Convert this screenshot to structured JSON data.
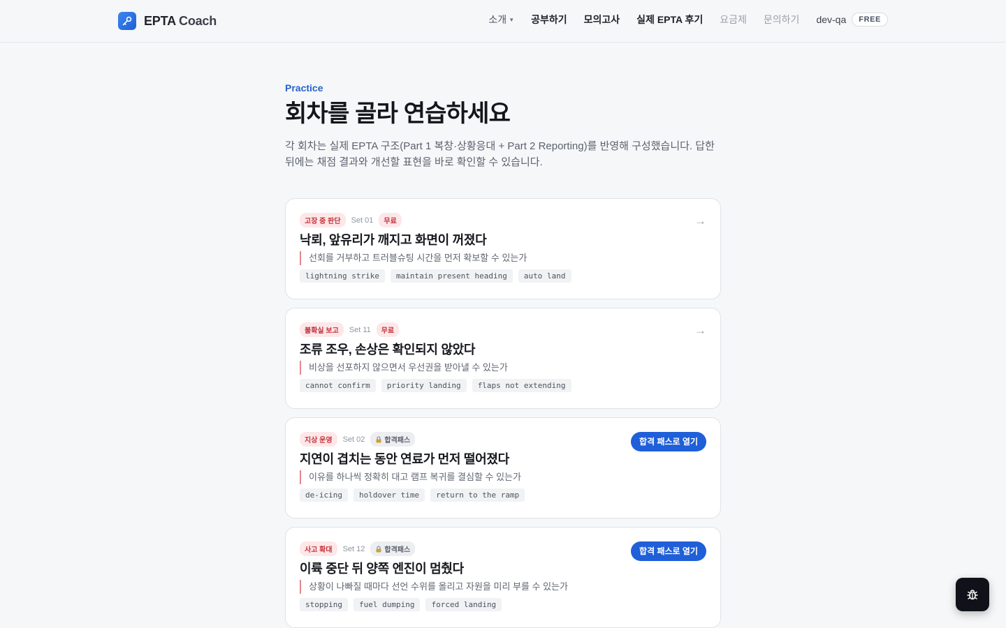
{
  "brand": {
    "name": "EPTA",
    "suffix": "Coach"
  },
  "nav": {
    "items": [
      {
        "label": "소개"
      },
      {
        "label": "공부하기"
      },
      {
        "label": "모의고사"
      },
      {
        "label": "실제 EPTA 후기"
      },
      {
        "label": "요금제"
      },
      {
        "label": "문의하기"
      }
    ],
    "user": "dev-qa",
    "plan": "FREE"
  },
  "intro": {
    "eyebrow": "Practice",
    "title": "회차를 골라 연습하세요",
    "description": "각 회차는 실제 EPTA 구조(Part 1 복창·상황응대 + Part 2 Reporting)를 반영해 구성했습니다. 답한 뒤에는 채점 결과와 개선할 표현을 바로 확인할 수 있습니다."
  },
  "cards": [
    {
      "category": "고장 중 판단",
      "set": "Set 01",
      "access": "무료",
      "title": "낙뢰, 앞유리가 깨지고 화면이 꺼졌다",
      "subtitle": "선회를 거부하고 트러블슈팅 시간을 먼저 확보할 수 있는가",
      "keywords": [
        "lightning strike",
        "maintain present heading",
        "auto land"
      ]
    },
    {
      "category": "불확실 보고",
      "set": "Set 11",
      "access": "무료",
      "title": "조류 조우, 손상은 확인되지 않았다",
      "subtitle": "비상을 선포하지 않으면서 우선권을 받아낼 수 있는가",
      "keywords": [
        "cannot confirm",
        "priority landing",
        "flaps not extending"
      ]
    },
    {
      "category": "지상 운영",
      "set": "Set 02",
      "access": "합격패스",
      "cta": "합격 패스로 열기",
      "title": "지연이 겹치는 동안 연료가 먼저 떨어졌다",
      "subtitle": "이유를 하나씩 정확히 대고 램프 복귀를 결심할 수 있는가",
      "keywords": [
        "de-icing",
        "holdover time",
        "return to the ramp"
      ]
    },
    {
      "category": "사고 확대",
      "set": "Set 12",
      "access": "합격패스",
      "cta": "합격 패스로 열기",
      "title": "이륙 중단 뒤 양쪽 엔진이 멈췄다",
      "subtitle": "상황이 나빠질 때마다 선언 수위를 올리고 자원을 미리 부를 수 있는가",
      "keywords": [
        "stopping",
        "fuel dumping",
        "forced landing"
      ]
    }
  ],
  "colors": {
    "accent": "#1f5fd8",
    "tag_red": "#c4323b",
    "tag_red_bg": "#fde7e8",
    "background": "#f6f7f9"
  },
  "icons": {
    "logo": "key-icon",
    "card_nav": "arrow-right-icon",
    "locked": "lock-icon",
    "feedback": "bug-icon"
  }
}
